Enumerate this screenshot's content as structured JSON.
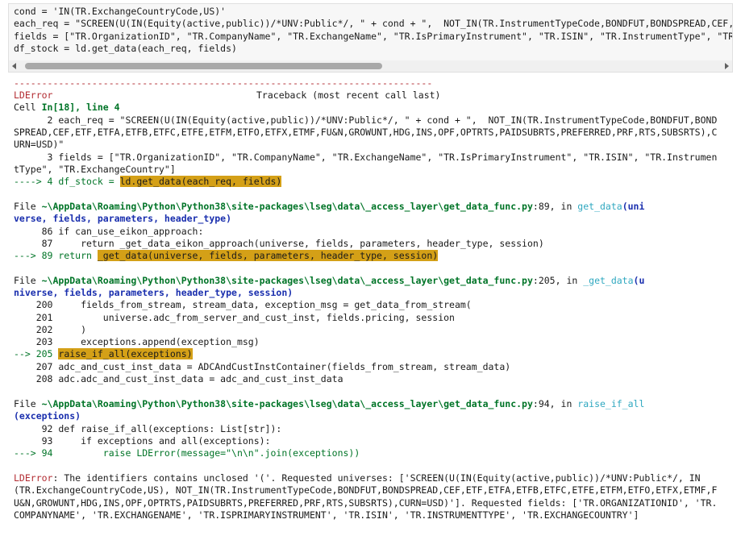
{
  "input_cell": {
    "lines": [
      "cond = 'IN(TR.ExchangeCountryCode,US)'",
      "each_req = \"SCREEN(U(IN(Equity(active,public))/*UNV:Public*/, \" + cond + \",  NOT_IN(TR.InstrumentTypeCode,BONDFUT,BONDSPREAD,CEF,ETF,",
      "fields = [\"TR.OrganizationID\", \"TR.CompanyName\", \"TR.ExchangeName\", \"TR.IsPrimaryInstrument\", \"TR.ISIN\", \"TR.InstrumentType\", \"TR.",
      "df_stock = ld.get_data(each_req, fields)"
    ]
  },
  "traceback": {
    "dashes": "---------------------------------------------------------------------------",
    "error_name": "LDError",
    "header": "Traceback (most recent call last)",
    "cell_prefix": "Cell ",
    "cell_ref": "In[18], line 4",
    "frame0": {
      "l2a": "      2 each_req = \"SCREEN(U(IN(Equity(active,public))/*UNV:Public*/, \" + cond + \",  NOT_IN(TR.InstrumentTypeCode,BONDFUT,BOND",
      "l2b": "SPREAD,CEF,ETF,ETFA,ETFB,ETFC,ETFE,ETFM,ETFO,ETFX,ETMF,FU&N,GROWUNT,HDG,INS,OPF,OPTRTS,PAIDSUBRTS,PREFERRED,PRF,RTS,SUBSRTS),C",
      "l2c": "URN=USD)\"",
      "l3a": "      3 fields = [\"TR.OrganizationID\", \"TR.CompanyName\", \"TR.ExchangeName\", \"TR.IsPrimaryInstrument\", \"TR.ISIN\", \"TR.Instrumen",
      "l3b": "tType\", \"TR.ExchangeCountry\"]",
      "arrow": "----> 4 df_stock = ",
      "hl": "ld.get_data(each_req, fields)"
    },
    "frame1": {
      "file_prefix": "File ",
      "path": "~\\AppData\\Roaming\\Python\\Python38\\site-packages\\lseg\\data\\_access_layer\\get_data_func.py",
      "loc": ":89, in ",
      "func": "get_data",
      "args_a": "(uni",
      "args_b": "verse, fields, parameters, header_type)",
      "l86": "     86 if can_use_eikon_approach:",
      "l87": "     87     return _get_data_eikon_approach(universe, fields, parameters, header_type, session)",
      "arrow": "---> 89 return ",
      "hl": "_get_data(universe, fields, parameters, header_type, session)"
    },
    "frame2": {
      "file_prefix": "File ",
      "path": "~\\AppData\\Roaming\\Python\\Python38\\site-packages\\lseg\\data\\_access_layer\\get_data_func.py",
      "loc": ":205, in ",
      "func": "_get_data",
      "args_a": "(u",
      "args_b": "niverse, fields, parameters, header_type, session)",
      "l200": "    200     fields_from_stream, stream_data, exception_msg = get_data_from_stream(",
      "l201": "    201         universe.adc_from_server_and_cust_inst, fields.pricing, session",
      "l202": "    202     )",
      "l203": "    203     exceptions.append(exception_msg)",
      "arrow": "--> 205 ",
      "hl": "raise_if_all(exceptions)",
      "l207": "    207 adc_and_cust_inst_data = ADCAndCustInstContainer(fields_from_stream, stream_data)",
      "l208": "    208 adc.adc_and_cust_inst_data = adc_and_cust_inst_data"
    },
    "frame3": {
      "file_prefix": "File ",
      "path": "~\\AppData\\Roaming\\Python\\Python38\\site-packages\\lseg\\data\\_access_layer\\get_data_func.py",
      "loc": ":94, in ",
      "func": "raise_if_all",
      "args_b": "(exceptions)",
      "l92": "     92 def raise_if_all(exceptions: List[str]):",
      "l93": "     93     if exceptions and all(exceptions):",
      "arrow": "---> 94         raise LDError(message=\"\\n\\n\".join(exceptions))"
    },
    "message": {
      "name": "LDError",
      "l1": ": The identifiers contains unclosed '('. Requested universes: ['SCREEN(U(IN(Equity(active,public))/*UNV:Public*/, IN",
      "l2": "(TR.ExchangeCountryCode,US), NOT_IN(TR.InstrumentTypeCode,BONDFUT,BONDSPREAD,CEF,ETF,ETFA,ETFB,ETFC,ETFE,ETFM,ETFO,ETFX,ETMF,F",
      "l3": "U&N,GROWUNT,HDG,INS,OPF,OPTRTS,PAIDSUBRTS,PREFERRED,PRF,RTS,SUBSRTS),CURN=USD)']. Requested fields: ['TR.ORGANIZATIONID', 'TR.",
      "l4": "COMPANYNAME', 'TR.EXCHANGENAME', 'TR.ISPRIMARYINSTRUMENT', 'TR.ISIN', 'TR.INSTRUMENTTYPE', 'TR.EXCHANGECOUNTRY']"
    }
  }
}
